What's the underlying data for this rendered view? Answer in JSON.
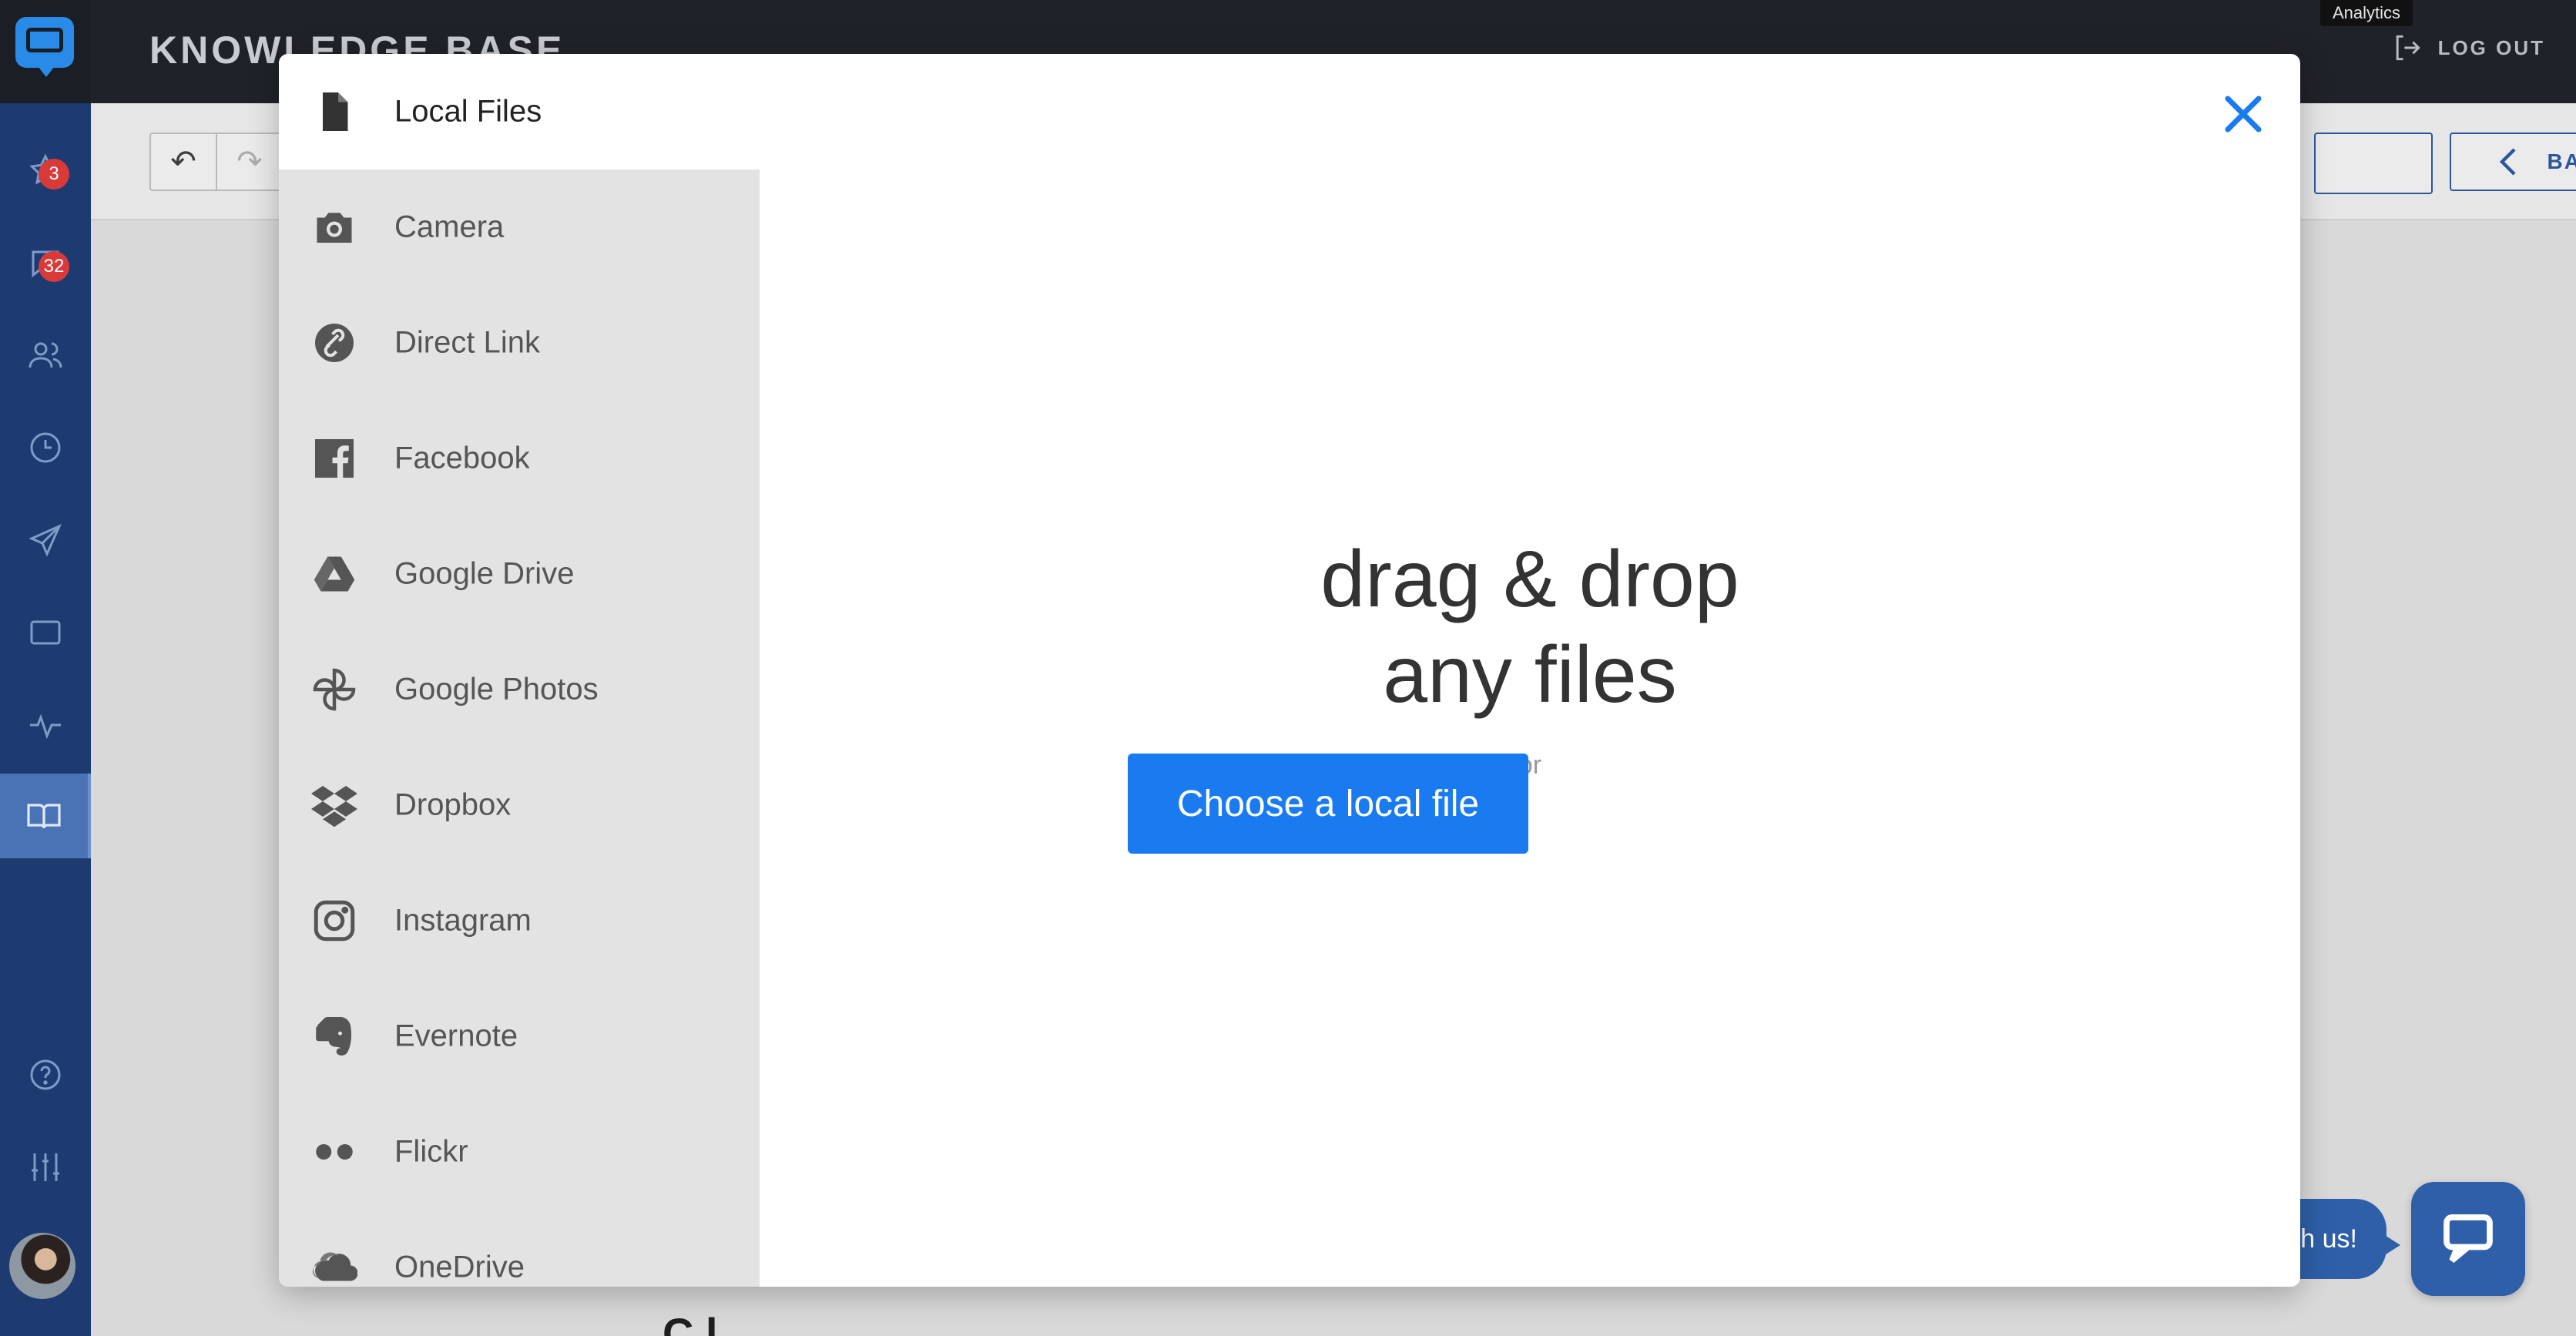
{
  "app": {
    "title": "KNOWLEDGE BASE",
    "logout_label": "LOG OUT",
    "analytics_tooltip": "Analytics",
    "back_label": "BACK",
    "chat_bubble_text": "h us!",
    "content_peek": "C l",
    "badges": {
      "favorites": "3",
      "messages": "32"
    },
    "colors": {
      "sidebar": "#1d3b70",
      "accent": "#1a7bf0",
      "topbar": "#1f2228"
    }
  },
  "sidebar_icons": [
    "star-icon",
    "chat-icon",
    "users-icon",
    "clock-icon",
    "send-icon",
    "window-icon",
    "pulse-icon",
    "book-icon",
    "help-icon",
    "sliders-icon"
  ],
  "picker": {
    "sources": [
      {
        "label": "Local Files",
        "icon": "file-icon",
        "active": true
      },
      {
        "label": "Camera",
        "icon": "camera-icon"
      },
      {
        "label": "Direct Link",
        "icon": "link-icon"
      },
      {
        "label": "Facebook",
        "icon": "facebook-icon"
      },
      {
        "label": "Google Drive",
        "icon": "google-drive-icon"
      },
      {
        "label": "Google Photos",
        "icon": "google-photos-icon"
      },
      {
        "label": "Dropbox",
        "icon": "dropbox-icon"
      },
      {
        "label": "Instagram",
        "icon": "instagram-icon"
      },
      {
        "label": "Evernote",
        "icon": "evernote-icon"
      },
      {
        "label": "Flickr",
        "icon": "flickr-icon"
      },
      {
        "label": "OneDrive",
        "icon": "onedrive-icon"
      }
    ],
    "drop_line1": "drag & drop",
    "drop_line2": "any files",
    "or_text": "or",
    "choose_button": "Choose a local file"
  }
}
